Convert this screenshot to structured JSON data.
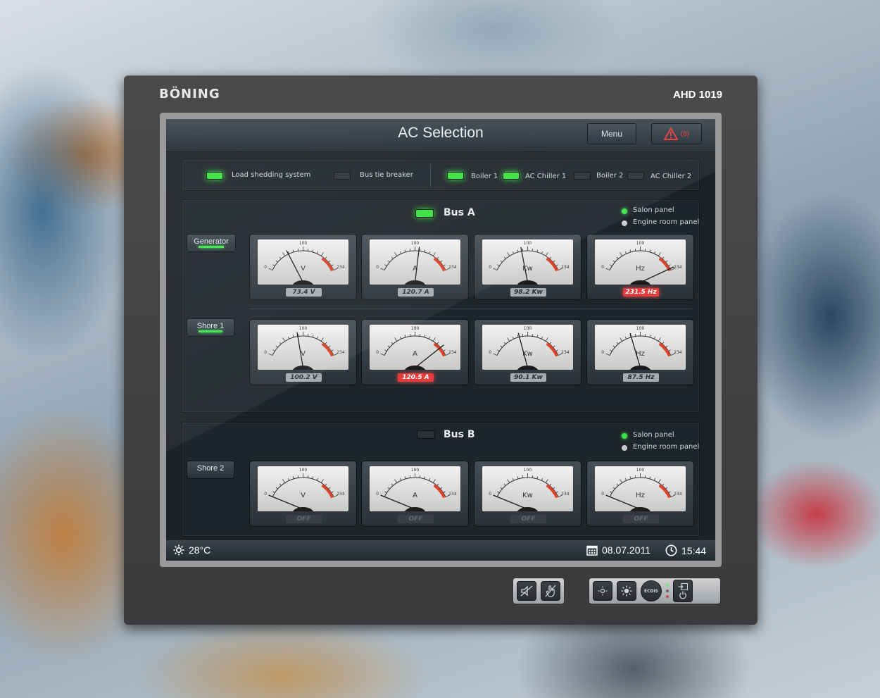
{
  "device": {
    "brand": "BÖNING",
    "model": "AHD 1019"
  },
  "header": {
    "title": "AC Selection",
    "menu_label": "Menu",
    "alarm_count": "(8)"
  },
  "status": [
    {
      "label": "Load shedding system",
      "on": true
    },
    {
      "label": "Bus tie breaker",
      "on": false
    },
    {
      "label": "Boiler 1",
      "on": true
    },
    {
      "label": "AC Chiller 1",
      "on": true
    },
    {
      "label": "Boiler 2",
      "on": false
    },
    {
      "label": "AC Chiller 2",
      "on": false
    }
  ],
  "scale": {
    "min": "0",
    "mid": "100",
    "max": "234"
  },
  "busA": {
    "title": "Bus A",
    "panels": {
      "salon": "Salon panel",
      "engine": "Engine room panel"
    },
    "sources": [
      {
        "label": "Generator",
        "meters": [
          {
            "unit": "V",
            "readout": "73.4 V",
            "needle": 0.3,
            "state": "normal"
          },
          {
            "unit": "A",
            "readout": "120.7 A",
            "needle": 0.55,
            "state": "normal"
          },
          {
            "unit": "Kw",
            "readout": "98.2 Kw",
            "needle": 0.42,
            "state": "normal"
          },
          {
            "unit": "Hz",
            "readout": "231.5 Hz",
            "needle": 0.98,
            "state": "alarm"
          }
        ]
      },
      {
        "label": "Shore 1",
        "meters": [
          {
            "unit": "V",
            "readout": "100.2 V",
            "needle": 0.43,
            "state": "normal"
          },
          {
            "unit": "A",
            "readout": "120.5 A",
            "needle": 0.88,
            "state": "alarm"
          },
          {
            "unit": "Kw",
            "readout": "90.1 Kw",
            "needle": 0.39,
            "state": "normal"
          },
          {
            "unit": "Hz",
            "readout": "87.5 Hz",
            "needle": 0.38,
            "state": "normal"
          }
        ]
      }
    ]
  },
  "busB": {
    "title": "Bus B",
    "panels": {
      "salon": "Salon panel",
      "engine": "Engine room panel"
    },
    "sources": [
      {
        "label": "Shore 2",
        "meters": [
          {
            "unit": "V",
            "readout": "OFF",
            "needle": 0.0,
            "state": "off"
          },
          {
            "unit": "A",
            "readout": "OFF",
            "needle": 0.0,
            "state": "off"
          },
          {
            "unit": "Kw",
            "readout": "OFF",
            "needle": 0.0,
            "state": "off"
          },
          {
            "unit": "Hz",
            "readout": "OFF",
            "needle": 0.0,
            "state": "off"
          }
        ]
      }
    ]
  },
  "footer": {
    "temperature": "28°C",
    "date": "08.07.2011",
    "time": "15:44"
  },
  "hardware": {
    "ecdis_label": "ECDIS"
  }
}
